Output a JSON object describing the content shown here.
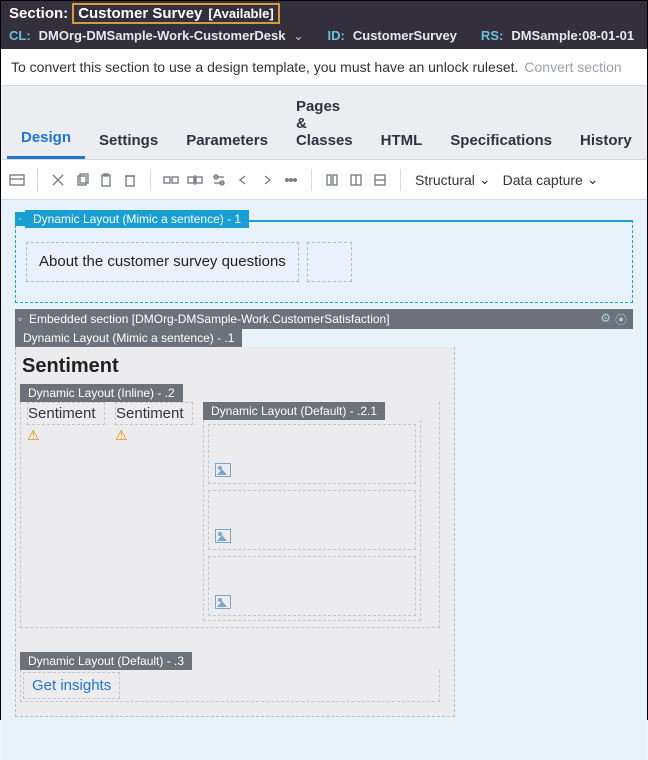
{
  "header": {
    "section_label": "Section:",
    "section_name": "Customer Survey",
    "status": "[Available]",
    "cl_key": "CL:",
    "cl_val": "DMOrg-DMSample-Work-CustomerDesk",
    "id_key": "ID:",
    "id_val": "CustomerSurvey",
    "rs_key": "RS:",
    "rs_val": "DMSample:08-01-01"
  },
  "infobar": {
    "message": "To convert this section to use a design template, you must have an unlock ruleset.",
    "convert_link": "Convert section"
  },
  "tabs": {
    "items": [
      "Design",
      "Settings",
      "Parameters",
      "Pages & Classes",
      "HTML",
      "Specifications",
      "History"
    ],
    "active": "Design"
  },
  "toolbar": {
    "structural": "Structural",
    "data_capture": "Data capture"
  },
  "canvas": {
    "dl1_label": "Dynamic Layout (Mimic a sentence) -    1",
    "about_text": "About the customer survey questions",
    "embedded_label": "Embedded section [DMOrg-DMSample-Work.CustomerSatisfaction]",
    "dl_mimic_1": "Dynamic Layout (Mimic a sentence) -    .1",
    "sentiment_heading": "Sentiment",
    "dl_inline_2": "Dynamic Layout (Inline) -    .2",
    "sentiment_col": "Sentiment",
    "dl_default_21": "Dynamic Layout (Default) -    .2.1",
    "dl_default_3": "Dynamic Layout (Default) -    .3",
    "get_insights": "Get insights"
  }
}
